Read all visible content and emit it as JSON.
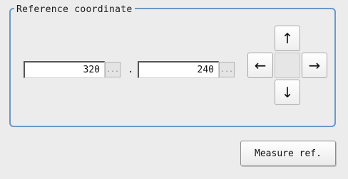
{
  "reference_coordinate": {
    "title": "Reference coordinate",
    "x_value": "320",
    "y_value": "240",
    "ellipsis_label": "...",
    "separator": "."
  },
  "direction_pad": {
    "up": "↑",
    "down": "↓",
    "left": "←",
    "right": "→"
  },
  "measure_button": {
    "label": "Measure ref."
  },
  "icons": {
    "up": "arrow-up-icon",
    "down": "arrow-down-icon",
    "left": "arrow-left-icon",
    "right": "arrow-right-icon"
  },
  "colors": {
    "group_border": "#6a98c8",
    "background": "#ececec"
  }
}
